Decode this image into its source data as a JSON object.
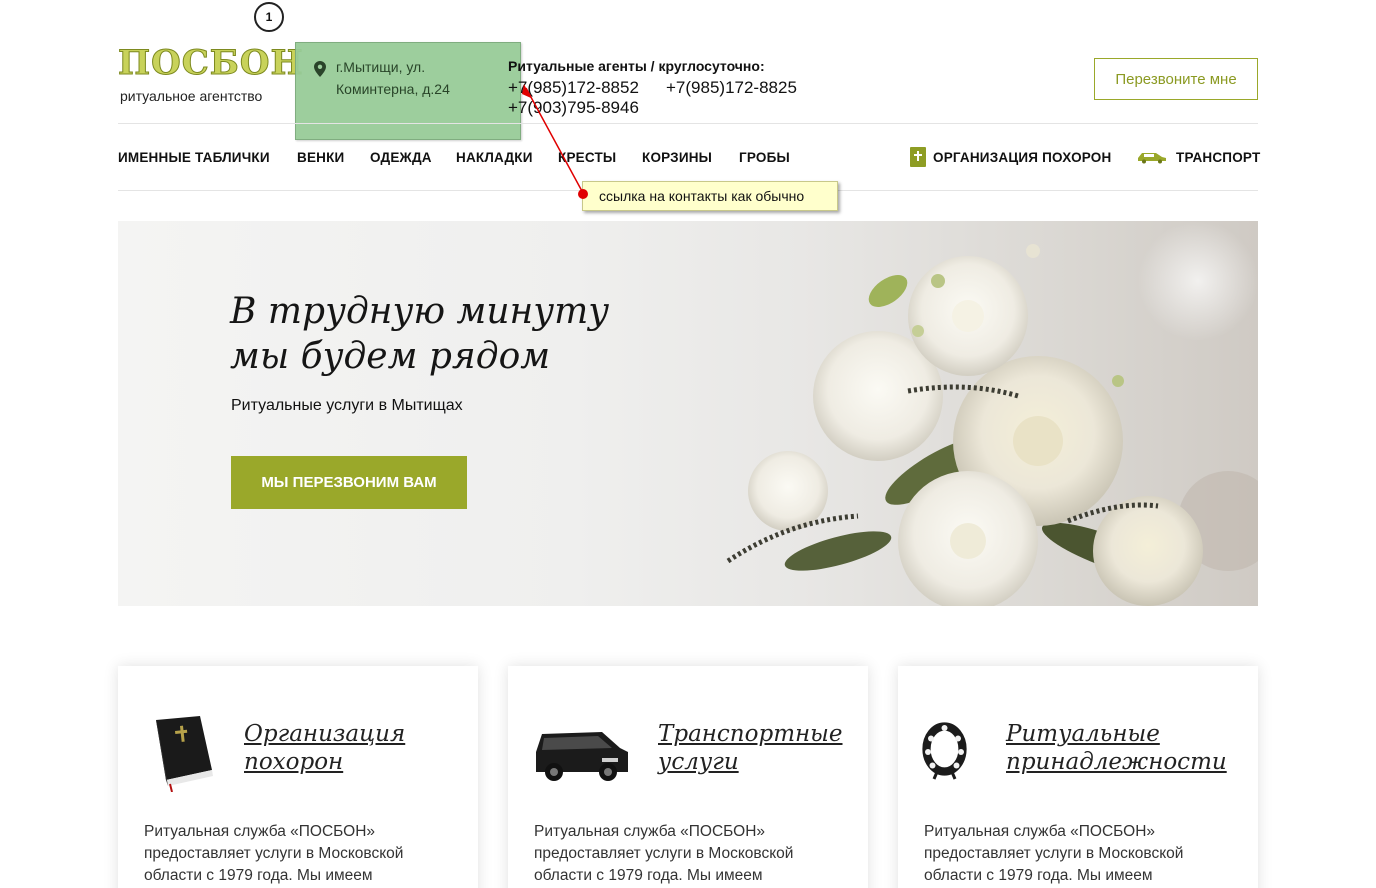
{
  "marker": "1",
  "logo": {
    "title": "ПОСБОН",
    "subtitle": "ритуальное агентство"
  },
  "address": {
    "line1": "г.Мытищи, ул.",
    "line2": "Коминтерна, д.24"
  },
  "contacts": {
    "title": "Ритуальные агенты / круглосуточно:",
    "phones": [
      "+7(985)172-8852",
      "+7(985)172-8825",
      "+7(903)795-8946"
    ]
  },
  "header": {
    "callback_label": "Перезвоните мне"
  },
  "nav": {
    "items": [
      "ИМЕННЫЕ ТАБЛИЧКИ",
      "ВЕНКИ",
      "ОДЕЖДА",
      "НАКЛАДКИ",
      "КРЕСТЫ",
      "КОРЗИНЫ",
      "ГРОБЫ"
    ],
    "organization": "ОРГАНИЗАЦИЯ ПОХОРОН",
    "transport": "ТРАНСПОРТ"
  },
  "annotation": {
    "text": "ссылка на контакты как обычно"
  },
  "hero": {
    "title_line1": "В трудную минуту",
    "title_line2": "мы будем рядом",
    "subtitle": "Ритуальные услуги в Мытищах",
    "button": "МЫ ПЕРЕЗВОНИМ ВАМ"
  },
  "cards": [
    {
      "title_line1": "Организация",
      "title_line2": "похорон",
      "icon": "bible-icon",
      "text_lines": [
        "Ритуальная служба «ПОСБОН»",
        "предоставляет услуги в Московской",
        "области с 1979 года. Мы имеем"
      ]
    },
    {
      "title_line1": "Транспортные",
      "title_line2": "услуги",
      "icon": "hearse-van-icon",
      "text_lines": [
        "Ритуальная служба «ПОСБОН»",
        "предоставляет услуги в Московской",
        "области с 1979 года. Мы имеем"
      ]
    },
    {
      "title_line1": "Ритуальные",
      "title_line2": "принадлежности",
      "icon": "funeral-wreath-icon",
      "text_lines": [
        "Ритуальная служба «ПОСБОН»",
        "предоставляет услуги в Московской",
        "области с 1979 года. Мы имеем"
      ]
    }
  ],
  "colors": {
    "accent": "#9aa82a",
    "note_green": "#98cc98",
    "annotation_yellow": "#ffffcc",
    "arrow_red": "#e00000"
  }
}
